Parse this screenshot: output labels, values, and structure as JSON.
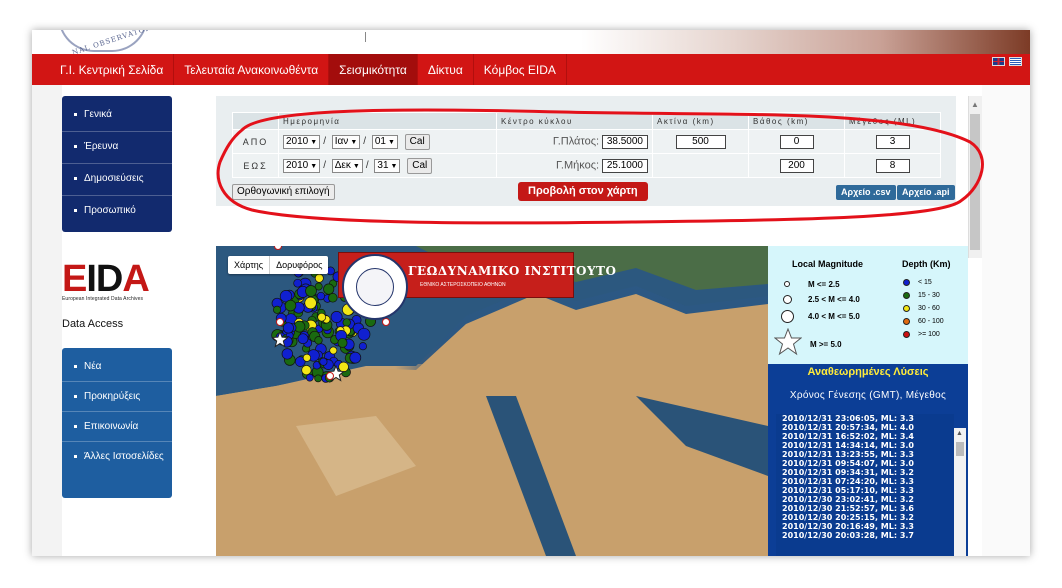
{
  "header": {
    "logo_arc_text": "NAL OBSERVATORY A"
  },
  "nav": {
    "items": [
      "Γ.Ι. Κεντρική Σελίδα",
      "Τελευταία Ανακοινωθέντα",
      "Σεισμικότητα",
      "Δίκτυα",
      "Κόμβος EIDA"
    ],
    "active_index": 2
  },
  "sidebar": {
    "menu1": [
      "Γενικά",
      "Έρευνα",
      "Δημοσιεύσεις",
      "Προσωπικό"
    ],
    "eida_letters": "EIDA",
    "eida_sub": "European Integrated Data Archives",
    "data_access": "Data Access",
    "menu2": [
      "Νέα",
      "Προκηρύξεις",
      "Επικοινωνία",
      "Άλλες Ιστοσελίδες"
    ]
  },
  "form": {
    "headers": [
      "Ημερομηνία",
      "Κέντρο κύκλου",
      "Ακτίνα (km)",
      "Βάθος (km)",
      "Μέγεθος (ML)"
    ],
    "from": {
      "label": "ΑΠΟ",
      "year": "2010",
      "month": "Ιαν",
      "day": "01",
      "cal": "Cal",
      "coord_label": "Γ.Πλάτος:",
      "coord_value": "38.5000",
      "radius": "500",
      "depth": "0",
      "mag": "3"
    },
    "to": {
      "label": "ΕΩΣ",
      "year": "2010",
      "month": "Δεκ",
      "day": "31",
      "cal": "Cal",
      "coord_label": "Γ.Μήκος:",
      "coord_value": "25.1000",
      "depth": "200",
      "mag": "8"
    },
    "ortho_button": "Ορθογωνική επιλογή",
    "map_button": "Προβολή στον χάρτη",
    "csv_button": "Αρχείο .csv",
    "api_button": "Αρχείο .api"
  },
  "map": {
    "tab_map": "Χάρτης",
    "tab_satellite": "Δορυφόρος",
    "banner_title": "ΓΕΩΔΥΝΑΜΙΚΟ ΙΝΣΤΙΤΟΥΤΟ",
    "banner_sub": "ΕΘΝΙΚΟ ΑΣΤΕΡΟΣΚΟΠΕΙΟ ΑΘΗΝΩΝ"
  },
  "legend": {
    "mag_title": "Local Magnitude",
    "depth_title": "Depth (Km)",
    "mag_rows": [
      "M <= 2.5",
      "2.5 < M <= 4.0",
      "4.0 < M <= 5.0",
      "M >= 5.0"
    ],
    "depth_rows": [
      "< 15",
      "15 - 30",
      "30 - 60",
      "60 - 100",
      ">= 100"
    ],
    "depth_colors": [
      "#1020d0",
      "#1a6a10",
      "#f2e616",
      "#e06a10",
      "#cc1010"
    ]
  },
  "events": {
    "title": "Αναθεωρημένες Λύσεις",
    "header": "Χρόνος Γένεσης (GMT), Μέγεθος",
    "rows": [
      "2010/12/31 23:06:05, ML: 3.3",
      "2010/12/31 20:57:34, ML: 4.0",
      "2010/12/31 16:52:02, ML: 3.4",
      "2010/12/31 14:34:14, ML: 3.0",
      "2010/12/31 13:23:55, ML: 3.3",
      "2010/12/31 09:54:07, ML: 3.0",
      "2010/12/31 09:34:31, ML: 3.2",
      "2010/12/31 07:24:20, ML: 3.3",
      "2010/12/31 05:17:10, ML: 3.3",
      "2010/12/30 23:02:41, ML: 3.2",
      "2010/12/30 21:52:57, ML: 3.6",
      "2010/12/30 20:25:15, ML: 3.2",
      "2010/12/30 20:16:49, ML: 3.3",
      "2010/12/30 20:03:28, ML: 3.7"
    ]
  }
}
